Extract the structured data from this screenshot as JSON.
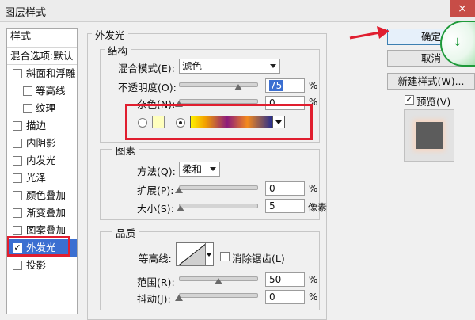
{
  "window": {
    "title": "图层样式",
    "close_glyph": "×"
  },
  "styles_panel": {
    "header": "样式",
    "blend_options": "混合选项:默认",
    "items": [
      {
        "label": "斜面和浮雕",
        "checked": false,
        "sub": false
      },
      {
        "label": "等高线",
        "checked": false,
        "sub": true
      },
      {
        "label": "纹理",
        "checked": false,
        "sub": true
      },
      {
        "label": "描边",
        "checked": false,
        "sub": false
      },
      {
        "label": "内阴影",
        "checked": false,
        "sub": false
      },
      {
        "label": "内发光",
        "checked": false,
        "sub": false
      },
      {
        "label": "光泽",
        "checked": false,
        "sub": false
      },
      {
        "label": "颜色叠加",
        "checked": false,
        "sub": false
      },
      {
        "label": "渐变叠加",
        "checked": false,
        "sub": false
      },
      {
        "label": "图案叠加",
        "checked": false,
        "sub": false
      },
      {
        "label": "外发光",
        "checked": true,
        "sub": false,
        "selected": true
      },
      {
        "label": "投影",
        "checked": false,
        "sub": false
      }
    ]
  },
  "outer_glow": {
    "title": "外发光",
    "structure": {
      "title": "结构",
      "blend_mode_label": "混合模式(E):",
      "blend_mode_value": "滤色",
      "opacity_label": "不透明度(O):",
      "opacity_value": "75",
      "opacity_unit": "%",
      "opacity_fraction": 0.75,
      "noise_label": "杂色(N):",
      "noise_value": "0",
      "noise_unit": "%",
      "noise_fraction": 0,
      "solid_color": "#ffffbe",
      "gradient_selected": true
    },
    "elements": {
      "title": "图素",
      "method_label": "方法(Q):",
      "method_value": "柔和",
      "spread_label": "扩展(P):",
      "spread_value": "0",
      "spread_unit": "%",
      "spread_fraction": 0,
      "size_label": "大小(S):",
      "size_value": "5",
      "size_unit": "像素",
      "size_fraction": 0.02
    },
    "quality": {
      "title": "品质",
      "contour_label": "等高线:",
      "antialias_label": "消除锯齿(L)",
      "antialias_checked": false,
      "range_label": "范围(R):",
      "range_value": "50",
      "range_unit": "%",
      "range_fraction": 0.5,
      "jitter_label": "抖动(J):",
      "jitter_value": "0",
      "jitter_unit": "%",
      "jitter_fraction": 0
    }
  },
  "buttons": {
    "ok": "确定",
    "cancel": "取消",
    "new_style": "新建样式(W)...",
    "preview_label": "预览(V)",
    "preview_checked": true
  },
  "colors": {
    "annotation_red": "#e01e2f",
    "selection_blue": "#3b6fd1"
  },
  "icons": {
    "checkmark": "✓",
    "close": "close-icon",
    "green_circle": "confirm-circle-icon"
  }
}
